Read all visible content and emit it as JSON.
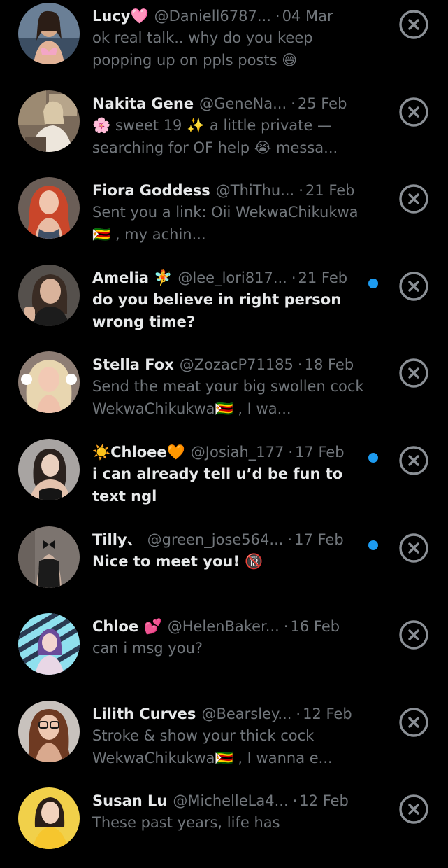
{
  "colors": {
    "background": "#000000",
    "primary_text": "#e7e9ea",
    "secondary_text": "#71767b",
    "unread_dot": "#1d9bf0",
    "close_icon": "#8b9096"
  },
  "conversations": [
    {
      "name": "Lucy🩷",
      "handle": "@Daniell6787...",
      "separator": "·",
      "date": "04 Mar",
      "preview": "ok real talk.. why do you keep popping up on ppls posts 😅",
      "unread": false,
      "avatar_icon": "avatar-photo",
      "action_icon": "close-icon"
    },
    {
      "name": "Nakita Gene",
      "handle": "@GeneNa...",
      "separator": "·",
      "date": "25 Feb",
      "preview": "🌸 sweet 19 ✨ a little private — searching for OF help 😭 messa...",
      "unread": false,
      "avatar_icon": "avatar-photo",
      "action_icon": "close-icon"
    },
    {
      "name": "Fiora Goddess",
      "handle": "@ThiThu...",
      "separator": "·",
      "date": "21 Feb",
      "preview": "Sent you a link: Oii WekwaChikukwa🇿🇼 , my achin...",
      "unread": false,
      "avatar_icon": "avatar-photo",
      "action_icon": "close-icon"
    },
    {
      "name": "Amelia 🧚",
      "handle": "@lee_lori817...",
      "separator": "·",
      "date": "21 Feb",
      "preview": "do you believe in right person wrong time?",
      "unread": true,
      "avatar_icon": "avatar-photo",
      "action_icon": "close-icon"
    },
    {
      "name": "Stella Fox",
      "handle": "@ZozacP71185",
      "separator": "·",
      "date": "18 Feb",
      "preview": "Send the meat your big swollen cock WekwaChikukwa🇿🇼 , I wa...",
      "unread": false,
      "avatar_icon": "avatar-photo",
      "action_icon": "close-icon"
    },
    {
      "name": "☀️Chloee🧡",
      "handle": "@Josiah_177",
      "separator": "·",
      "date": "17 Feb",
      "preview": "i can already tell u’d be fun to text ngl",
      "unread": true,
      "avatar_icon": "avatar-photo",
      "action_icon": "close-icon"
    },
    {
      "name": "Tilly、",
      "handle": "@green_jose564...",
      "separator": "·",
      "date": "17 Feb",
      "preview": "Nice to meet you! 🔞",
      "unread": true,
      "avatar_icon": "avatar-photo",
      "action_icon": "close-icon"
    },
    {
      "name": "Chloe 💕",
      "handle": "@HelenBaker...",
      "separator": "·",
      "date": "16 Feb",
      "preview": "can i msg you?",
      "unread": false,
      "avatar_icon": "avatar-photo",
      "action_icon": "close-icon"
    },
    {
      "name": "Lilith Curves",
      "handle": "@Bearsley...",
      "separator": "·",
      "date": "12 Feb",
      "preview": "Stroke & show your thick cock WekwaChikukwa🇿🇼 , I wanna e...",
      "unread": false,
      "avatar_icon": "avatar-photo",
      "action_icon": "close-icon"
    },
    {
      "name": "Susan Lu",
      "handle": "@MichelleLa4...",
      "separator": "·",
      "date": "12 Feb",
      "preview": "These past years, life has",
      "unread": false,
      "avatar_icon": "avatar-photo",
      "action_icon": "close-icon"
    }
  ]
}
